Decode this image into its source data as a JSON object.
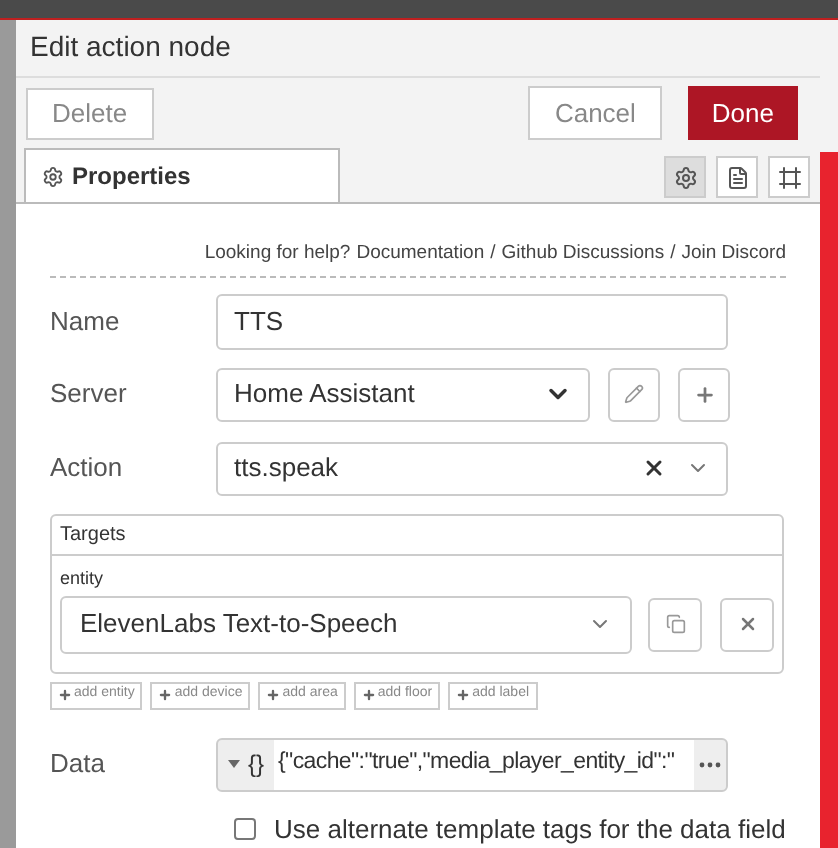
{
  "dialog": {
    "title": "Edit action node"
  },
  "toolbar": {
    "delete": "Delete",
    "cancel": "Cancel",
    "done": "Done"
  },
  "tabs": [
    {
      "label": "Properties",
      "selected": true
    }
  ],
  "side_tabs": [
    {
      "kind": "gear",
      "selected": true
    },
    {
      "kind": "document",
      "selected": false
    },
    {
      "kind": "frame",
      "selected": false
    }
  ],
  "help": {
    "prompt": "Looking for help?",
    "links": [
      "Documentation",
      "Github Discussions",
      "Join Discord"
    ],
    "separators": [
      "/",
      "/"
    ]
  },
  "name": {
    "label": "Name",
    "value": "TTS"
  },
  "server": {
    "label": "Server",
    "value": "Home Assistant"
  },
  "action": {
    "label": "Action",
    "value": "tts.speak"
  },
  "targets": {
    "title": "Targets",
    "entity_label": "entity",
    "entity_value": "ElevenLabs Text-to-Speech",
    "add_buttons": [
      "add entity",
      "add device",
      "add area",
      "add floor",
      "add label"
    ]
  },
  "data": {
    "label": "Data",
    "type_label": "{}",
    "value": "{\"cache\":\"true\",\"media_player_entity_id\":\""
  },
  "alternate_tags": {
    "label": "Use alternate template tags for the data field",
    "checked": false
  }
}
